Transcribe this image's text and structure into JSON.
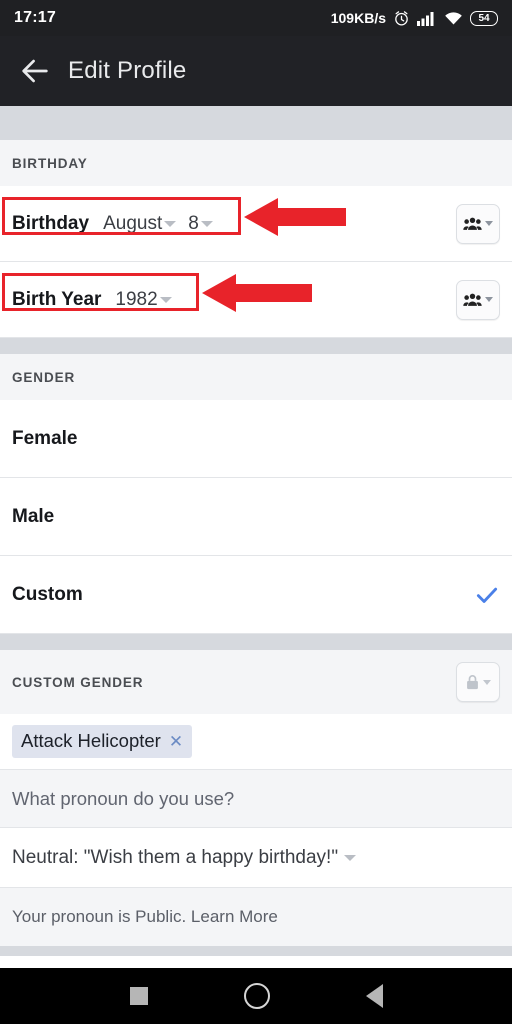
{
  "status_bar": {
    "time": "17:17",
    "network_rate": "109KB/s",
    "battery_level": "54",
    "icons": [
      "alarm-icon",
      "signal-icon",
      "wifi-icon",
      "battery-icon"
    ]
  },
  "app_bar": {
    "back_icon": "back-arrow-icon",
    "title": "Edit Profile"
  },
  "sections": {
    "birthday": {
      "header": "BIRTHDAY",
      "rows": [
        {
          "label": "Birthday",
          "month": "August",
          "day": "8",
          "privacy_icon": "friends-icon",
          "privacy_value": "Friends"
        },
        {
          "label": "Birth Year",
          "year": "1982",
          "privacy_icon": "friends-icon",
          "privacy_value": "Friends"
        }
      ]
    },
    "gender": {
      "header": "GENDER",
      "options": [
        {
          "label": "Female",
          "selected": false
        },
        {
          "label": "Male",
          "selected": false
        },
        {
          "label": "Custom",
          "selected": true
        }
      ],
      "check_color": "#4a80e8"
    },
    "custom_gender": {
      "header": "CUSTOM GENDER",
      "privacy_icon": "lock-icon",
      "privacy_value": "Only me",
      "chip": {
        "text": "Attack Helicopter",
        "remove_icon": "close-icon"
      },
      "pronoun_placeholder": "What pronoun do you use?",
      "pronoun_value": "Neutral: \"Wish them a happy birthday!\"",
      "footer_note": "Your pronoun is Public. Learn More"
    }
  },
  "annotations": {
    "accent_color": "#e8232a",
    "highlights": [
      {
        "target": "birthday-row",
        "shape": "rectangle"
      },
      {
        "target": "birth-year-row",
        "shape": "rectangle"
      }
    ],
    "arrows": [
      {
        "target": "birthday-row",
        "direction": "left"
      },
      {
        "target": "birth-year-row",
        "direction": "left"
      }
    ]
  },
  "nav_bar": {
    "buttons": [
      {
        "name": "recent-apps",
        "icon": "square-icon"
      },
      {
        "name": "home",
        "icon": "circle-icon"
      },
      {
        "name": "back",
        "icon": "triangle-left-icon"
      }
    ]
  }
}
